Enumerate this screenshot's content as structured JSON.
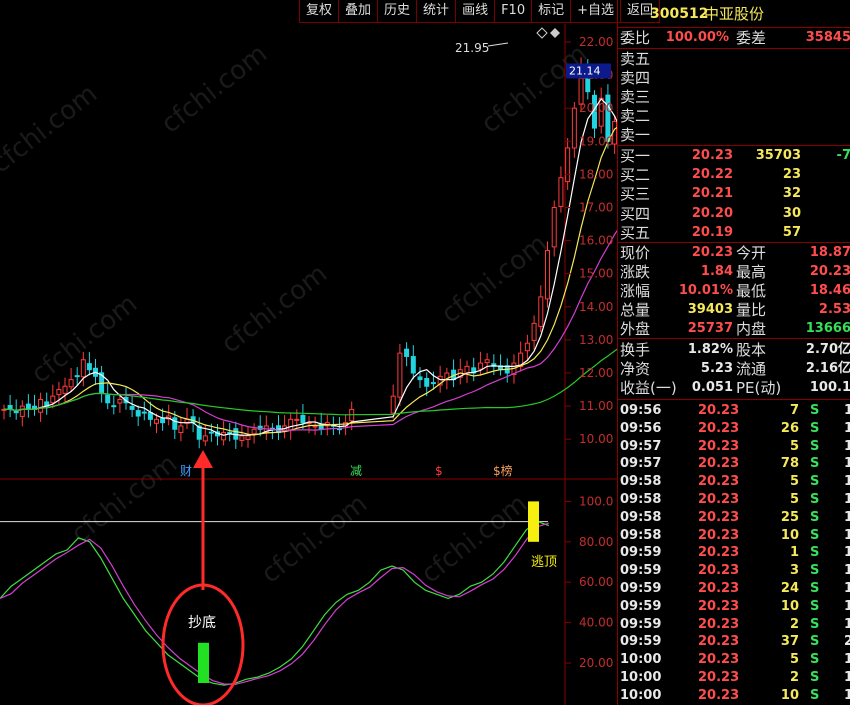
{
  "toolbar": {
    "items": [
      "复权",
      "叠加",
      "历史",
      "统计",
      "画线",
      "F10",
      "标记",
      "+自选",
      "返回"
    ]
  },
  "stock": {
    "code": "300512",
    "name": "中亚股份"
  },
  "order_ratio": {
    "wb_label": "委比",
    "wb_value": "100.00%",
    "wc_label": "委差",
    "wc_value": "35845"
  },
  "asks": [
    {
      "label": "卖五"
    },
    {
      "label": "卖四"
    },
    {
      "label": "卖三"
    },
    {
      "label": "卖二"
    },
    {
      "label": "卖一"
    }
  ],
  "bids": [
    {
      "label": "买一",
      "price": "20.23",
      "vol": "35703",
      "chg": "-7"
    },
    {
      "label": "买二",
      "price": "20.22",
      "vol": "23",
      "chg": ""
    },
    {
      "label": "买三",
      "price": "20.21",
      "vol": "32",
      "chg": ""
    },
    {
      "label": "买四",
      "price": "20.20",
      "vol": "30",
      "chg": ""
    },
    {
      "label": "买五",
      "price": "20.19",
      "vol": "57",
      "chg": ""
    }
  ],
  "quote": [
    {
      "l1": "现价",
      "v1": "20.23",
      "l2": "今开",
      "v2": "18.87",
      "c1": "red",
      "c2": "red"
    },
    {
      "l1": "涨跌",
      "v1": "1.84",
      "l2": "最高",
      "v2": "20.23",
      "c1": "red",
      "c2": "red"
    },
    {
      "l1": "涨幅",
      "v1": "10.01%",
      "l2": "最低",
      "v2": "18.46",
      "c1": "red",
      "c2": "red"
    },
    {
      "l1": "总量",
      "v1": "39403",
      "l2": "量比",
      "v2": "2.53",
      "c1": "yel",
      "c2": "red"
    },
    {
      "l1": "外盘",
      "v1": "25737",
      "l2": "内盘",
      "v2": "13666",
      "c1": "red",
      "c2": "grn"
    }
  ],
  "fundamentals": [
    {
      "l1": "换手",
      "v1": "1.82%",
      "l2": "股本",
      "v2": "2.70亿"
    },
    {
      "l1": "净资",
      "v1": "5.23",
      "l2": "流通",
      "v2": "2.16亿"
    },
    {
      "l1": "收益(一)",
      "v1": "0.051",
      "l2": "PE(动)",
      "v2": "100.1"
    }
  ],
  "ticks": [
    {
      "t": "09:56",
      "p": "20.23",
      "v": "7",
      "s": "S",
      "n": "1"
    },
    {
      "t": "09:56",
      "p": "20.23",
      "v": "26",
      "s": "S",
      "n": "1"
    },
    {
      "t": "09:57",
      "p": "20.23",
      "v": "5",
      "s": "S",
      "n": "1"
    },
    {
      "t": "09:57",
      "p": "20.23",
      "v": "78",
      "s": "S",
      "n": "1"
    },
    {
      "t": "09:58",
      "p": "20.23",
      "v": "5",
      "s": "S",
      "n": "1"
    },
    {
      "t": "09:58",
      "p": "20.23",
      "v": "5",
      "s": "S",
      "n": "1"
    },
    {
      "t": "09:58",
      "p": "20.23",
      "v": "25",
      "s": "S",
      "n": "1"
    },
    {
      "t": "09:58",
      "p": "20.23",
      "v": "10",
      "s": "S",
      "n": "1"
    },
    {
      "t": "09:59",
      "p": "20.23",
      "v": "1",
      "s": "S",
      "n": "1"
    },
    {
      "t": "09:59",
      "p": "20.23",
      "v": "3",
      "s": "S",
      "n": "1"
    },
    {
      "t": "09:59",
      "p": "20.23",
      "v": "24",
      "s": "S",
      "n": "1"
    },
    {
      "t": "09:59",
      "p": "20.23",
      "v": "10",
      "s": "S",
      "n": "1"
    },
    {
      "t": "09:59",
      "p": "20.23",
      "v": "2",
      "s": "S",
      "n": "1"
    },
    {
      "t": "09:59",
      "p": "20.23",
      "v": "37",
      "s": "S",
      "n": "2"
    },
    {
      "t": "10:00",
      "p": "20.23",
      "v": "5",
      "s": "S",
      "n": "1"
    },
    {
      "t": "10:00",
      "p": "20.23",
      "v": "2",
      "s": "S",
      "n": "1"
    },
    {
      "t": "10:00",
      "p": "20.23",
      "v": "10",
      "s": "S",
      "n": "1"
    }
  ],
  "chart": {
    "price_ticks": [
      "22.00",
      "21.00",
      "20.00",
      "19.00",
      "18.00",
      "17.00",
      "16.00",
      "15.00",
      "14.00",
      "13.00",
      "12.00",
      "11.00",
      "10.00"
    ],
    "current_price": "21.14",
    "peak_label": "21.95",
    "event_markers": [
      "财",
      "减",
      "$",
      "$榜"
    ],
    "osc_ticks": [
      "100.0",
      "80.00",
      "60.00",
      "40.00",
      "20.00"
    ],
    "bottom_label": "抄底",
    "top_label": "逃顶",
    "watermark": "cfchi.com"
  },
  "colors": {
    "up": "#ff3b3b",
    "down": "#22d4e0",
    "ma5": "#ffffff",
    "ma10": "#f5e85a",
    "ma20": "#d23fd2",
    "ma60": "#28c828",
    "grid": "#8a0000"
  }
}
